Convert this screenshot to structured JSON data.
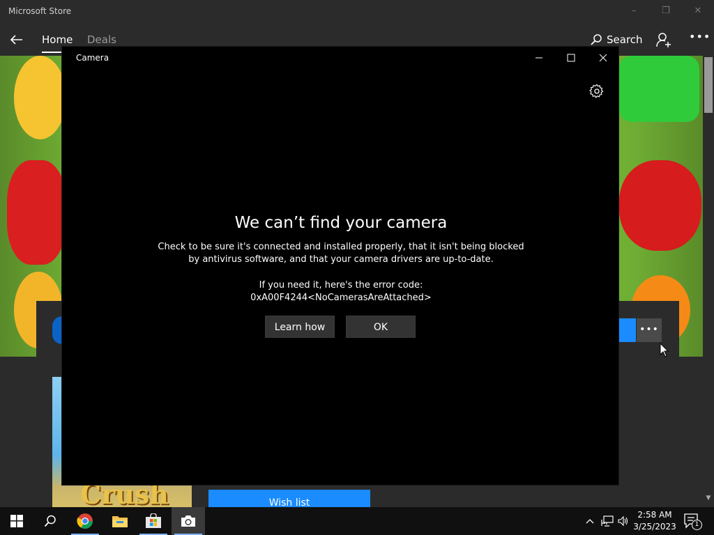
{
  "store": {
    "title": "Microsoft Store",
    "nav": {
      "home": "Home",
      "deals": "Deals",
      "search": "Search"
    },
    "card": {
      "wishlist": "Wish list",
      "thumb_text": "Crush"
    }
  },
  "camera": {
    "title": "Camera",
    "error": {
      "title": "We can’t find your camera",
      "line1": "Check to be sure it's connected and installed properly, that it isn't being blocked",
      "line2": "by antivirus software, and that your camera drivers are up-to-date.",
      "code_label": "If you need it, here's the error code:",
      "code": "0xA00F4244<NoCamerasAreAttached>"
    },
    "buttons": {
      "learn_how": "Learn how",
      "ok": "OK"
    }
  },
  "taskbar": {
    "apps": [
      "start-icon",
      "search-icon",
      "chrome-icon",
      "file-explorer-icon",
      "store-icon",
      "camera-icon"
    ],
    "time": "2:58 AM",
    "date": "3/25/2023",
    "notification_count": "1"
  },
  "colors": {
    "accent": "#1a8cff",
    "window_bg": "#000000",
    "store_bg": "#2b2b2b",
    "taskbar_bg": "#101010"
  }
}
